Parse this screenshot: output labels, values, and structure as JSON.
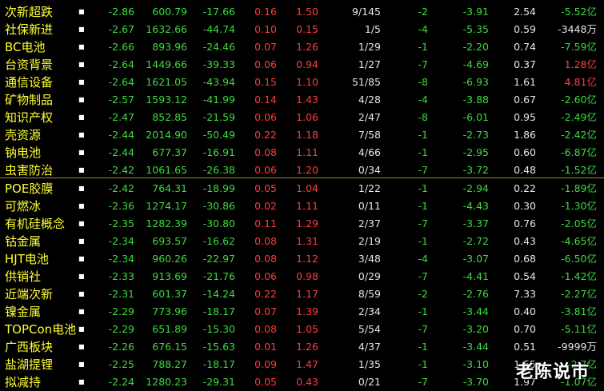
{
  "colors": {
    "background": "#000000",
    "name": "#ffff33",
    "down": "#3cdc3c",
    "up": "#ff3c3c",
    "neutral": "#e6e6e6",
    "divider": "#a08c28"
  },
  "rows": [
    {
      "name": "次新超跌",
      "c1": "-2.86",
      "c2": "600.79",
      "c3": "-17.66",
      "c4": "0.16",
      "c5": "1.50",
      "c6": "9/145",
      "c7": "-2",
      "c8": "-3.91",
      "c9": "2.54",
      "c10": "-5.52亿",
      "c10_color": "down"
    },
    {
      "name": "社保新进",
      "c1": "-2.67",
      "c2": "1632.66",
      "c3": "-44.74",
      "c4": "0.10",
      "c5": "0.15",
      "c6": "1/5",
      "c7": "-4",
      "c8": "-5.35",
      "c9": "0.59",
      "c10": "-3448万",
      "c10_color": "neutral"
    },
    {
      "name": "BC电池",
      "c1": "-2.66",
      "c2": "893.96",
      "c3": "-24.46",
      "c4": "0.07",
      "c5": "1.26",
      "c6": "1/29",
      "c7": "-1",
      "c8": "-2.20",
      "c9": "0.74",
      "c10": "-7.59亿",
      "c10_color": "down"
    },
    {
      "name": "台资背景",
      "c1": "-2.64",
      "c2": "1449.66",
      "c3": "-39.33",
      "c4": "0.06",
      "c5": "0.94",
      "c6": "1/27",
      "c7": "-7",
      "c8": "-4.69",
      "c9": "0.37",
      "c10": "1.28亿",
      "c10_color": "up"
    },
    {
      "name": "通信设备",
      "c1": "-2.64",
      "c2": "1621.05",
      "c3": "-43.94",
      "c4": "0.15",
      "c5": "1.10",
      "c6": "51/85",
      "c7": "-8",
      "c8": "-6.93",
      "c9": "1.61",
      "c10": "4.81亿",
      "c10_color": "up"
    },
    {
      "name": "矿物制品",
      "c1": "-2.57",
      "c2": "1593.12",
      "c3": "-41.99",
      "c4": "0.14",
      "c5": "1.43",
      "c6": "4/28",
      "c7": "-4",
      "c8": "-3.88",
      "c9": "0.67",
      "c10": "-2.60亿",
      "c10_color": "down"
    },
    {
      "name": "知识产权",
      "c1": "-2.47",
      "c2": "852.85",
      "c3": "-21.59",
      "c4": "0.06",
      "c5": "1.06",
      "c6": "2/47",
      "c7": "-8",
      "c8": "-6.01",
      "c9": "0.95",
      "c10": "-2.49亿",
      "c10_color": "down"
    },
    {
      "name": "壳资源",
      "c1": "-2.44",
      "c2": "2014.90",
      "c3": "-50.49",
      "c4": "0.22",
      "c5": "1.18",
      "c6": "7/58",
      "c7": "-1",
      "c8": "-2.73",
      "c9": "1.86",
      "c10": "-2.42亿",
      "c10_color": "down"
    },
    {
      "name": "钠电池",
      "c1": "-2.44",
      "c2": "677.37",
      "c3": "-16.91",
      "c4": "0.08",
      "c5": "1.11",
      "c6": "4/66",
      "c7": "-1",
      "c8": "-2.95",
      "c9": "0.60",
      "c10": "-6.87亿",
      "c10_color": "down"
    },
    {
      "name": "虫害防治",
      "c1": "-2.42",
      "c2": "1061.65",
      "c3": "-26.38",
      "c4": "0.06",
      "c5": "1.20",
      "c6": "0/34",
      "c7": "-7",
      "c8": "-3.72",
      "c9": "0.48",
      "c10": "-1.52亿",
      "c10_color": "down"
    },
    {
      "name": "POE胶膜",
      "c1": "-2.42",
      "c2": "764.31",
      "c3": "-18.99",
      "c4": "0.05",
      "c5": "1.04",
      "c6": "1/22",
      "c7": "-1",
      "c8": "-2.94",
      "c9": "0.22",
      "c10": "-1.89亿",
      "c10_color": "down"
    },
    {
      "name": "可燃冰",
      "c1": "-2.36",
      "c2": "1274.17",
      "c3": "-30.86",
      "c4": "0.02",
      "c5": "1.11",
      "c6": "0/11",
      "c7": "-1",
      "c8": "-4.43",
      "c9": "0.30",
      "c10": "-1.30亿",
      "c10_color": "down"
    },
    {
      "name": "有机硅概念",
      "c1": "-2.35",
      "c2": "1282.39",
      "c3": "-30.80",
      "c4": "0.11",
      "c5": "1.29",
      "c6": "2/37",
      "c7": "-7",
      "c8": "-3.37",
      "c9": "0.76",
      "c10": "-2.05亿",
      "c10_color": "down"
    },
    {
      "name": "钴金属",
      "c1": "-2.34",
      "c2": "693.57",
      "c3": "-16.62",
      "c4": "0.08",
      "c5": "1.31",
      "c6": "2/19",
      "c7": "-1",
      "c8": "-2.72",
      "c9": "0.43",
      "c10": "-4.65亿",
      "c10_color": "down"
    },
    {
      "name": "HJT电池",
      "c1": "-2.34",
      "c2": "960.26",
      "c3": "-22.97",
      "c4": "0.08",
      "c5": "1.12",
      "c6": "3/48",
      "c7": "-4",
      "c8": "-3.07",
      "c9": "0.68",
      "c10": "-6.50亿",
      "c10_color": "down"
    },
    {
      "name": "供销社",
      "c1": "-2.33",
      "c2": "913.69",
      "c3": "-21.76",
      "c4": "0.06",
      "c5": "0.98",
      "c6": "0/29",
      "c7": "-7",
      "c8": "-4.41",
      "c9": "0.54",
      "c10": "-1.42亿",
      "c10_color": "down"
    },
    {
      "name": "近端次新",
      "c1": "-2.31",
      "c2": "601.37",
      "c3": "-14.24",
      "c4": "0.22",
      "c5": "1.17",
      "c6": "8/59",
      "c7": "-2",
      "c8": "-2.76",
      "c9": "7.33",
      "c10": "-2.27亿",
      "c10_color": "down"
    },
    {
      "name": "镍金属",
      "c1": "-2.29",
      "c2": "773.96",
      "c3": "-18.17",
      "c4": "0.07",
      "c5": "1.39",
      "c6": "2/34",
      "c7": "-1",
      "c8": "-3.44",
      "c9": "0.40",
      "c10": "-3.81亿",
      "c10_color": "down"
    },
    {
      "name": "TOPCon电池",
      "c1": "-2.29",
      "c2": "651.89",
      "c3": "-15.30",
      "c4": "0.08",
      "c5": "1.05",
      "c6": "5/54",
      "c7": "-7",
      "c8": "-3.20",
      "c9": "0.70",
      "c10": "-5.11亿",
      "c10_color": "down"
    },
    {
      "name": "广西板块",
      "c1": "-2.26",
      "c2": "676.15",
      "c3": "-15.63",
      "c4": "0.01",
      "c5": "1.26",
      "c6": "4/37",
      "c7": "-1",
      "c8": "-3.44",
      "c9": "0.51",
      "c10": "-9999万",
      "c10_color": "neutral"
    },
    {
      "name": "盐湖提锂",
      "c1": "-2.25",
      "c2": "788.27",
      "c3": "-18.17",
      "c4": "0.09",
      "c5": "1.47",
      "c6": "1/35",
      "c7": "-1",
      "c8": "-3.10",
      "c9": "1.55",
      "c10": "-2.7亿",
      "c10_color": "down"
    },
    {
      "name": "拟减持",
      "c1": "-2.24",
      "c2": "1280.23",
      "c3": "-29.31",
      "c4": "0.05",
      "c5": "0.43",
      "c6": "0/21",
      "c7": "-7",
      "c8": "-3.70",
      "c9": "1.97",
      "c10": "-1.07亿",
      "c10_color": "down"
    }
  ],
  "watermark": "老陈说市"
}
